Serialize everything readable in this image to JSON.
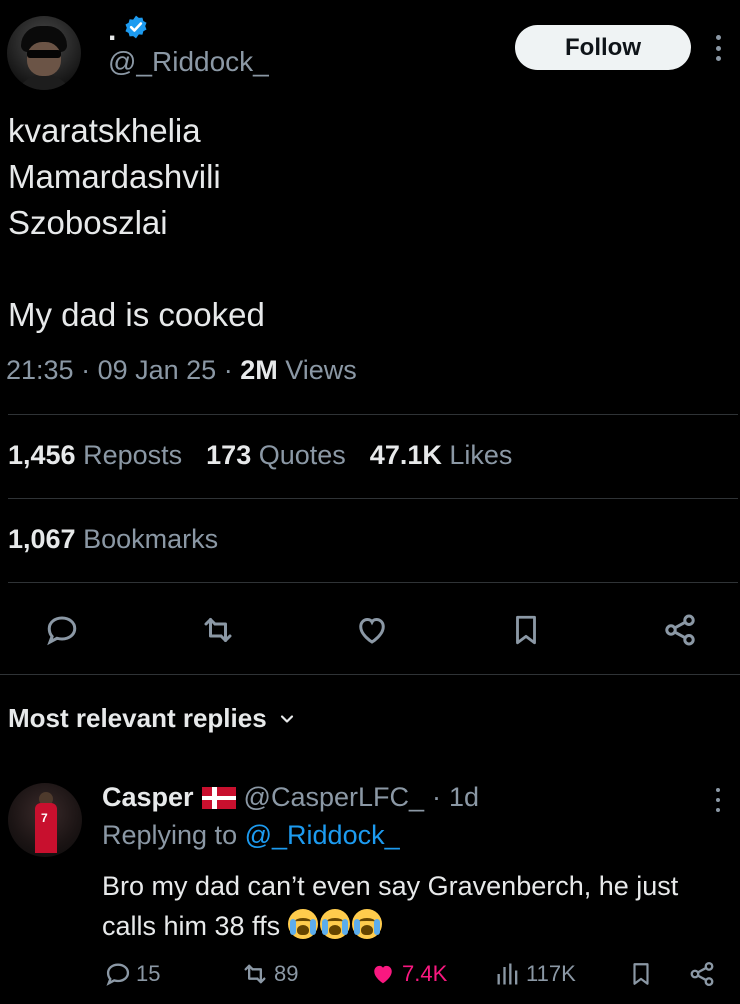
{
  "author": {
    "display_name": ".",
    "handle": "@_Riddock_",
    "verified": true
  },
  "follow_button": {
    "label": "Follow"
  },
  "tweet": {
    "text": "kvaratskhelia\nMamardashvili\nSzoboszlai\n\nMy dad is cooked",
    "time": "21:35",
    "date": "09 Jan 25",
    "views_count": "2M",
    "views_label": "Views"
  },
  "stats": {
    "reposts_count": "1,456",
    "reposts_label": "Reposts",
    "quotes_count": "173",
    "quotes_label": "Quotes",
    "likes_count": "47.1K",
    "likes_label": "Likes",
    "bookmarks_count": "1,067",
    "bookmarks_label": "Bookmarks"
  },
  "actions": [
    "reply-icon",
    "repost-icon",
    "like-icon",
    "bookmark-icon",
    "share-icon"
  ],
  "replies_section": {
    "title": "Most relevant replies"
  },
  "reply": {
    "name": "Casper",
    "flag": "Denmark",
    "handle": "@CasperLFC_",
    "age": "1d",
    "replying_to_label": "Replying to",
    "replying_to_handle": "@_Riddock_",
    "text": "Bro my dad can’t even say Gravenberch, he just calls him 38 ffs",
    "emoji": [
      "loudly-crying-face",
      "loudly-crying-face",
      "loudly-crying-face"
    ],
    "replies": "15",
    "reposts": "89",
    "likes": "7.4K",
    "views": "117K"
  },
  "colors": {
    "background": "#000000",
    "text": "#e7e9ea",
    "secondary": "#8b98a5",
    "accent": "#1d9bf0",
    "like": "#f91880",
    "divider": "#2f3336"
  }
}
